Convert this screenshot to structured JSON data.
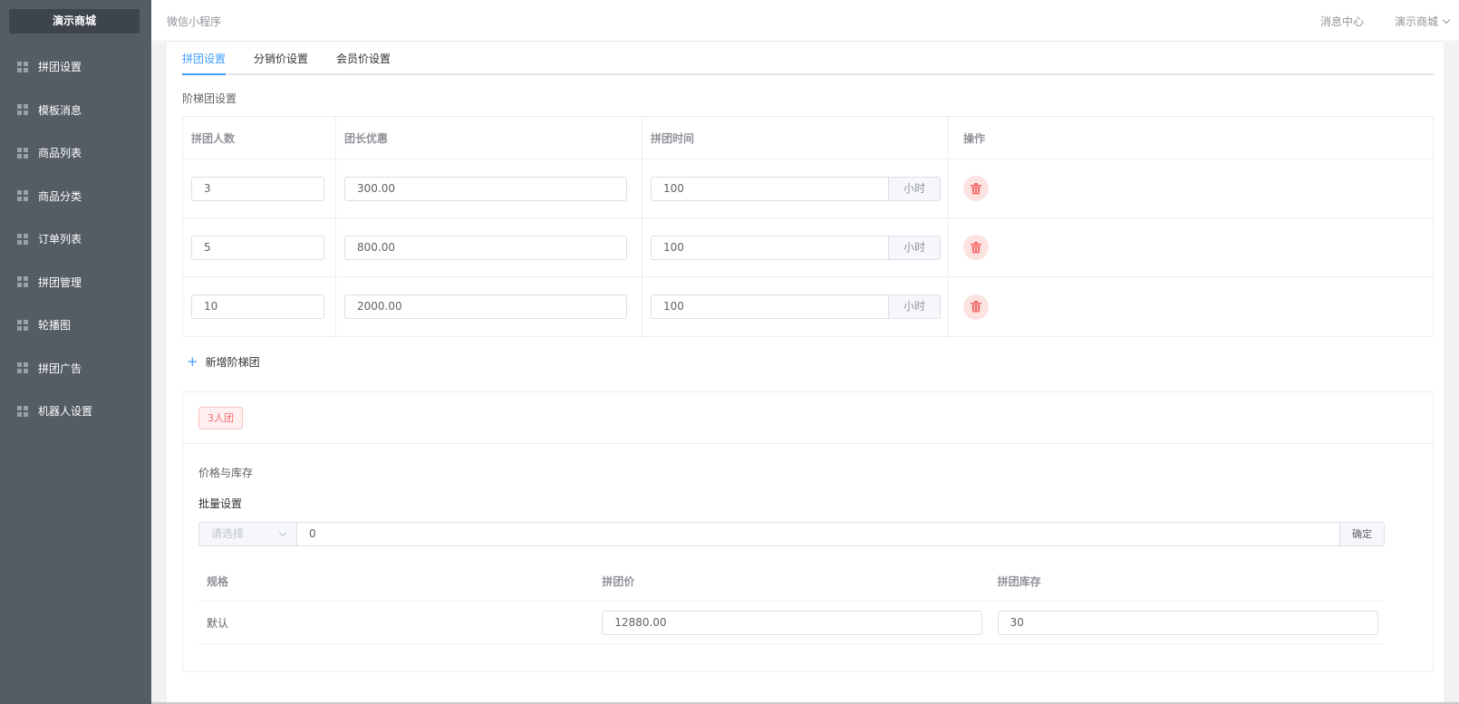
{
  "brand": "演示商城",
  "sidebar": {
    "items": [
      {
        "label": "拼团设置"
      },
      {
        "label": "模板消息"
      },
      {
        "label": "商品列表"
      },
      {
        "label": "商品分类"
      },
      {
        "label": "订单列表"
      },
      {
        "label": "拼团管理"
      },
      {
        "label": "轮播图"
      },
      {
        "label": "拼团广告"
      },
      {
        "label": "机器人设置"
      }
    ]
  },
  "header": {
    "app_name": "微信小程序",
    "message_center": "消息中心",
    "user_menu": "演示商城"
  },
  "tabs": [
    {
      "label": "拼团设置",
      "active": true
    },
    {
      "label": "分销价设置",
      "active": false
    },
    {
      "label": "会员价设置",
      "active": false
    }
  ],
  "ladder": {
    "section_title": "阶梯团设置",
    "headers": [
      "拼团人数",
      "团长优惠",
      "拼团时间",
      "操作"
    ],
    "unit": "小时",
    "rows": [
      {
        "people": "3",
        "leader_discount": "300.00",
        "time": "100"
      },
      {
        "people": "5",
        "leader_discount": "800.00",
        "time": "100"
      },
      {
        "people": "10",
        "leader_discount": "2000.00",
        "time": "100"
      }
    ],
    "add_label": "新增阶梯团"
  },
  "group_card": {
    "tag": "3人团",
    "price_stock_label": "价格与库存",
    "batch_label": "批量设置",
    "batch_select_placeholder": "请选择",
    "batch_value": "0",
    "confirm_label": "确定",
    "spec_headers": [
      "规格",
      "拼团价",
      "拼团库存"
    ],
    "spec_rows": [
      {
        "spec": "默认",
        "price": "12880.00",
        "stock": "30"
      }
    ]
  },
  "colors": {
    "sidebar_bg": "#545c64",
    "brand_bg": "#3e444b",
    "accent": "#409eff",
    "danger": "#f56c6c"
  }
}
